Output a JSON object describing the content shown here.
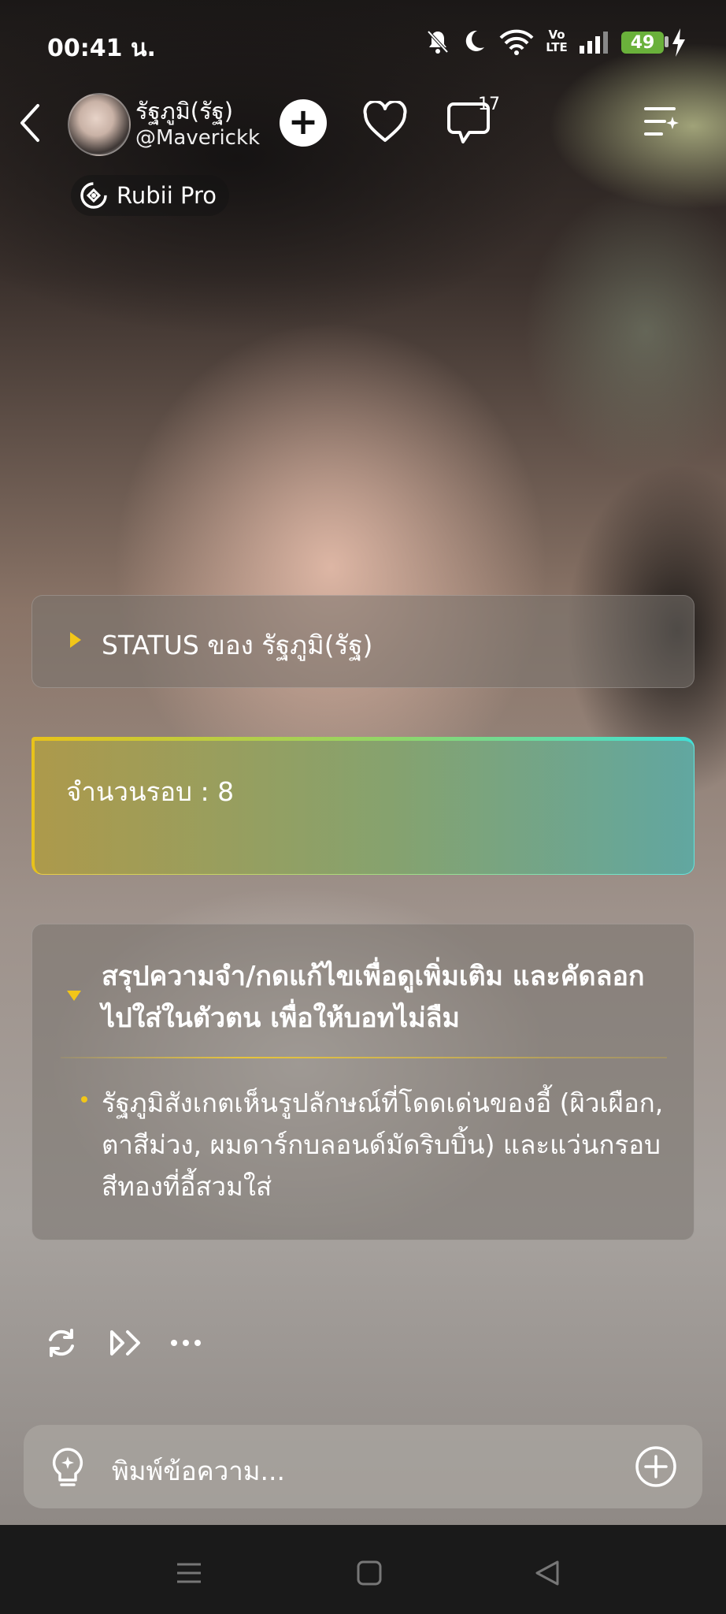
{
  "status_bar": {
    "time": "00:41 น.",
    "network": "Vo LTE",
    "battery": "49"
  },
  "header": {
    "character_name": "รัฐภูมิ(รัฐ)",
    "character_handle": "@Maverickk",
    "message_count": "17",
    "plan_label": "Rubii Pro"
  },
  "cards": {
    "status_title": "STATUS ของ รัฐภูมิ(รัฐ)",
    "round_count": "จำนวนรอบ : 8",
    "memory_title": "สรุปความจำ/กดแก้ไขเพื่อดูเพิ่มเติม และคัดลอกไปใส่ในตัวตน เพื่อให้บอทไม่ลืม",
    "memory_item": "รัฐภูมิสังเกตเห็นรูปลักษณ์ที่โดดเด่นของอี้ (ผิวเผือก, ตาสีม่วง, ผมดาร์กบลอนด์มัดริบบิ้น) และแว่นกรอบสีทองที่อี้สวมใส่"
  },
  "composer": {
    "placeholder": "พิมพ์ข้อความ..."
  },
  "colors": {
    "accent_yellow": "#f2c618",
    "battery_green": "#6ab13b",
    "gradient_cyan": "#3fe0d8"
  }
}
